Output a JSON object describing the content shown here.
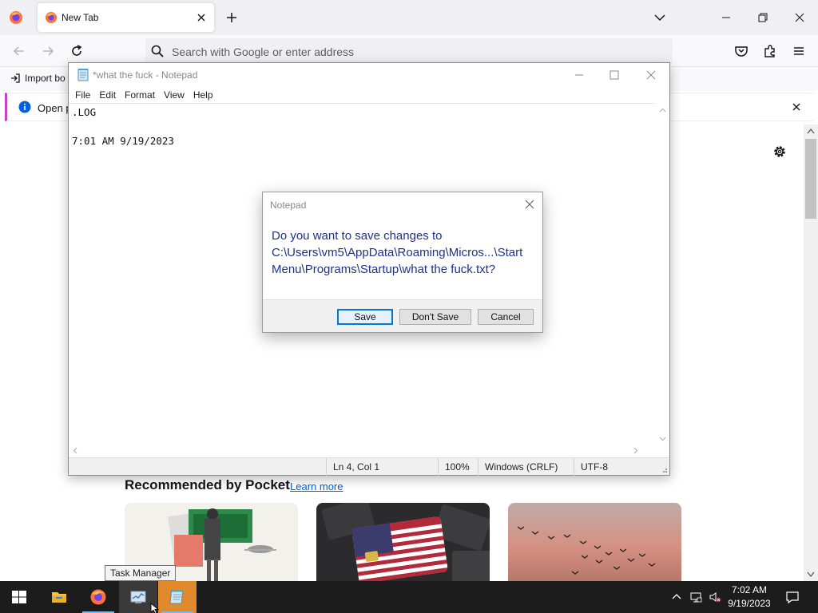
{
  "browser": {
    "tab_title": "New Tab",
    "url_placeholder": "Search with Google or enter address",
    "bookmark_import": "Import bo",
    "notice_text": "Open pr"
  },
  "pocket": {
    "heading": "Recommended by Pocket",
    "learn_more": "Learn more"
  },
  "notepad": {
    "title": "*what the fuck - Notepad",
    "menu": [
      "File",
      "Edit",
      "Format",
      "View",
      "Help"
    ],
    "content": ".LOG\n\n7:01 AM 9/19/2023",
    "status": {
      "position": "Ln 4, Col 1",
      "zoom": "100%",
      "line_ending": "Windows (CRLF)",
      "encoding": "UTF-8"
    }
  },
  "dialog": {
    "title": "Notepad",
    "message": "Do you want to save changes to C:\\Users\\vm5\\AppData\\Roaming\\Micros...\\Start Menu\\Programs\\Startup\\what the fuck.txt?",
    "save_label": "Save",
    "dont_save_label": "Don't Save",
    "cancel_label": "Cancel"
  },
  "taskbar": {
    "tooltip": "Task Manager",
    "time": "7:02 AM",
    "date": "9/19/2023"
  },
  "colors": {
    "dialog_text": "#1e3287",
    "accent": "#0078d7",
    "notice_accent": "#c644c8"
  }
}
